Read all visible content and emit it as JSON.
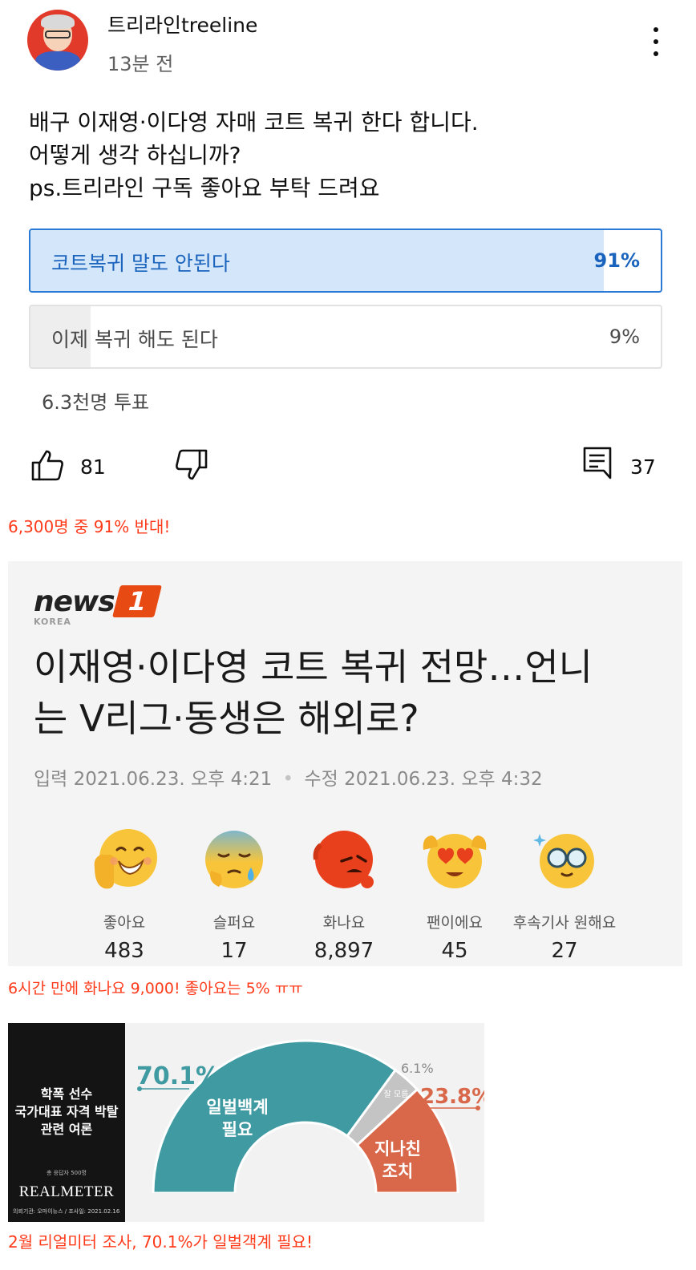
{
  "post": {
    "author": "트리라인treeline",
    "time": "13분 전",
    "lines": [
      "배구 이재영·이다영 자매 코트 복귀 한다 합니다.",
      "어떻게 생각 하십니까?",
      "ps.트리라인 구독 좋아요 부탁 드려요"
    ]
  },
  "poll": {
    "options": [
      {
        "label": "코트복귀 말도 안된다",
        "pct": "91%",
        "fraction": 0.91,
        "selected": true
      },
      {
        "label": "이제 복귀 해도 된다",
        "pct": "9%",
        "fraction": 0.09,
        "selected": false
      }
    ],
    "votes": "6.3천명 투표"
  },
  "actions": {
    "likes": "81",
    "comments": "37",
    "icons": [
      "thumbs-up-icon",
      "thumbs-down-icon",
      "comment-icon",
      "more-vert-icon"
    ]
  },
  "captions": {
    "c1": "6,300명 중 91% 반대!",
    "c2": "6시간 만에 화나요 9,000! 좋아요는 5% ㅠㅠ",
    "c3": "2월 리얼미터 조사, 70.1%가 일벌객계 필요!"
  },
  "news": {
    "logo_word": "news",
    "logo_badge": "1",
    "logo_sub": "KOREA",
    "headline": [
      "이재영·이다영 코트 복귀 전망…언니",
      "는 V리그·동생은 해외로?"
    ],
    "published_label": "입력",
    "published": "2021.06.23. 오후 4:21",
    "modified_label": "수정",
    "modified": "2021.06.23. 오후 4:32",
    "reactions": [
      {
        "label": "좋아요",
        "count": "483",
        "icon": "like-emoji-icon"
      },
      {
        "label": "슬퍼요",
        "count": "17",
        "icon": "sad-emoji-icon"
      },
      {
        "label": "화나요",
        "count": "8,897",
        "icon": "angry-emoji-icon"
      },
      {
        "label": "팬이에요",
        "count": "45",
        "icon": "fan-emoji-icon"
      },
      {
        "label": "후속기사 원해요",
        "count": "27",
        "icon": "follow-up-emoji-icon"
      }
    ],
    "colors": {
      "brand": "#e84a14",
      "panel": "#f4f4f4"
    }
  },
  "realmeter": {
    "title_lines": [
      "학폭 선수",
      "국가대표 자격 박탈",
      "관련 여론"
    ],
    "sample": "총 응답자 500명",
    "brand": "REALMETER",
    "source": "의뢰기관: 오마이뉴스  /  조사일: 2021.02.16",
    "colors": {
      "teal": "#3f9aa2",
      "gray": "#c4c4c4",
      "red": "#d9674a"
    }
  },
  "chart_data": {
    "type": "pie",
    "categories": [
      "일벌백계 필요",
      "잘 모름",
      "지나친 조치"
    ],
    "values": [
      70.1,
      6.1,
      23.8
    ],
    "value_labels": [
      "70.1%",
      "6.1%",
      "23.8%"
    ],
    "colors": [
      "#3f9aa2",
      "#c4c4c4",
      "#d9674a"
    ],
    "shape": "half-donut"
  }
}
